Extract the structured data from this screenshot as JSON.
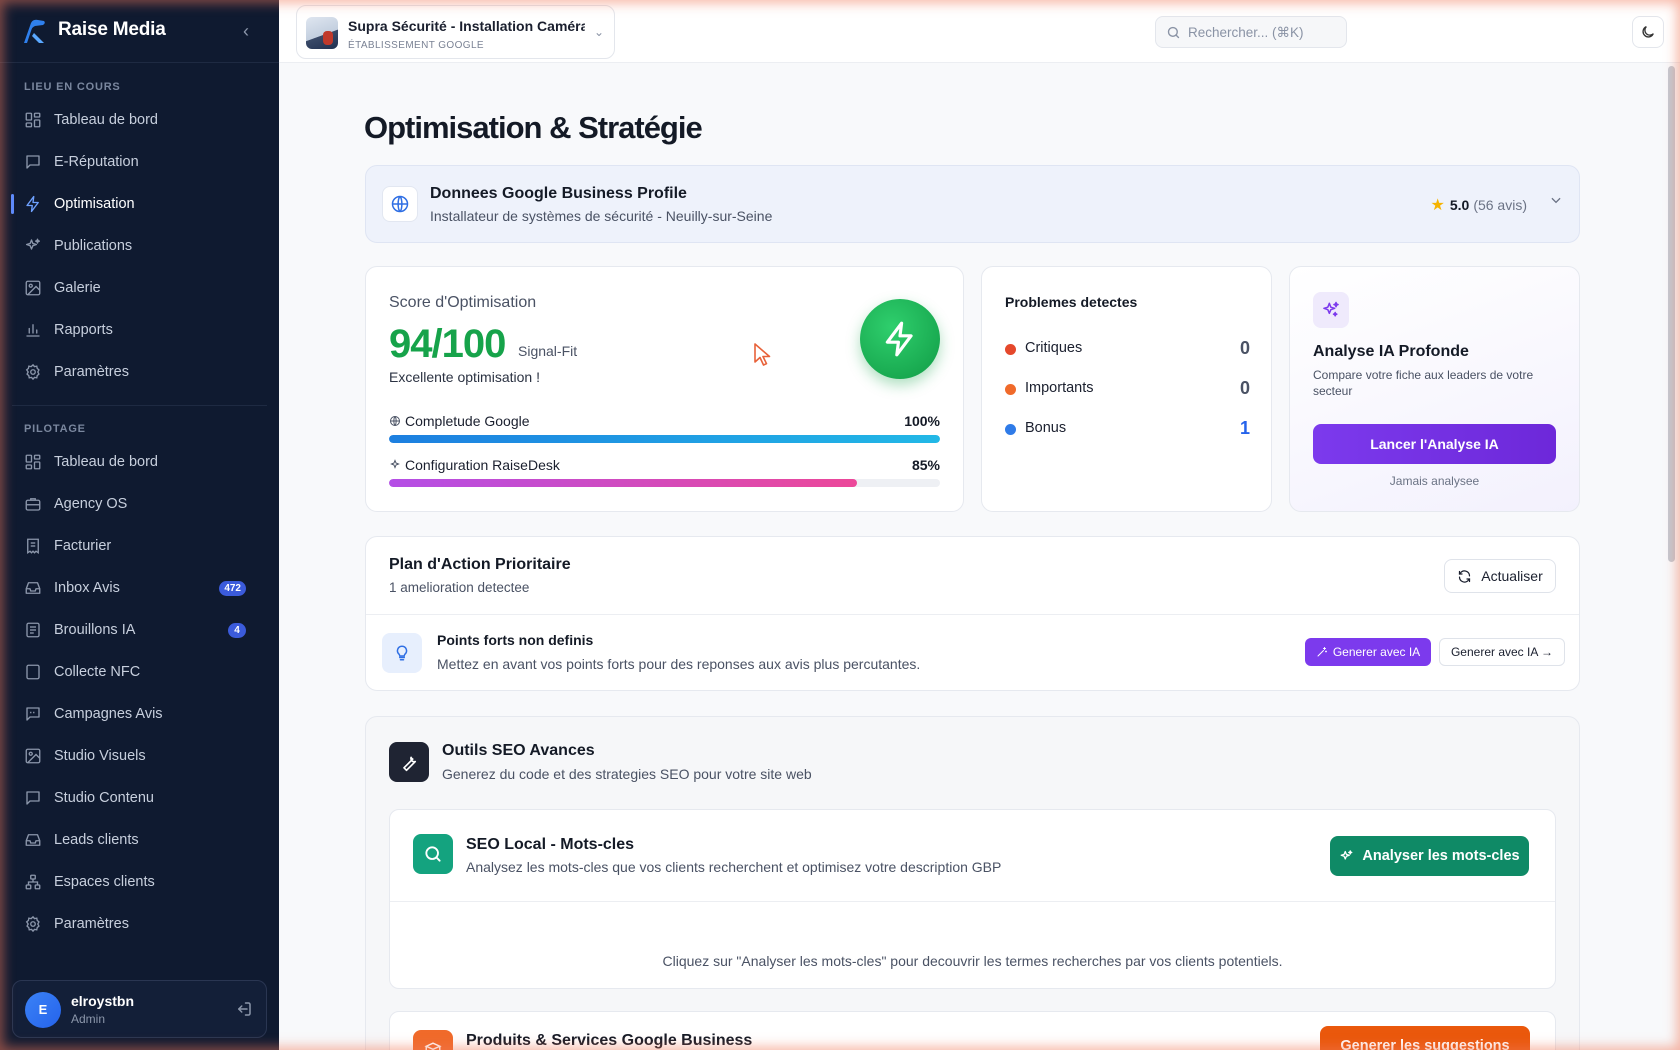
{
  "app": {
    "name": "Raise Media",
    "collapse_icon": "chevron-left-icon"
  },
  "sidebar": {
    "section_current": "LIEU EN COURS",
    "current_items": [
      {
        "label": "Tableau de bord",
        "icon": "dashboard-icon"
      },
      {
        "label": "E-Réputation",
        "icon": "message-square-icon"
      },
      {
        "label": "Optimisation",
        "icon": "zap-icon",
        "active": true
      },
      {
        "label": "Publications",
        "icon": "sparkles-icon"
      },
      {
        "label": "Galerie",
        "icon": "image-icon"
      },
      {
        "label": "Rapports",
        "icon": "bar-chart-icon"
      },
      {
        "label": "Paramètres",
        "icon": "gear-icon"
      }
    ],
    "section_pilotage": "PILOTAGE",
    "pilotage_items": [
      {
        "label": "Tableau de bord",
        "icon": "dashboard-icon"
      },
      {
        "label": "Agency OS",
        "icon": "briefcase-icon"
      },
      {
        "label": "Facturier",
        "icon": "receipt-icon"
      },
      {
        "label": "Inbox Avis",
        "icon": "inbox-icon",
        "badge": "472"
      },
      {
        "label": "Brouillons IA",
        "icon": "file-text-icon",
        "badge": "4"
      },
      {
        "label": "Collecte NFC",
        "icon": "nfc-card-icon"
      },
      {
        "label": "Campagnes Avis",
        "icon": "message-quote-icon"
      },
      {
        "label": "Studio Visuels",
        "icon": "image-icon"
      },
      {
        "label": "Studio Contenu",
        "icon": "message-square-icon"
      },
      {
        "label": "Leads clients",
        "icon": "inbox-icon"
      },
      {
        "label": "Espaces clients",
        "icon": "network-icon"
      },
      {
        "label": "Paramètres",
        "icon": "gear-icon"
      }
    ],
    "user": {
      "initial": "E",
      "name": "elroystbn",
      "role": "Admin"
    }
  },
  "topbar": {
    "location_name": "Supra Sécurité - Installation Caméra, ...",
    "location_sub": "ÉTABLISSEMENT GOOGLE",
    "search_placeholder": "Rechercher... (⌘K)",
    "theme_icon": "moon-icon"
  },
  "page": {
    "title": "Optimisation & Stratégie",
    "gbp": {
      "title": "Donnees Google Business Profile",
      "subtitle": "Installateur de systèmes de sécurité - Neuilly-sur-Seine",
      "rating": "5.0",
      "reviews": "(56 avis)"
    },
    "score": {
      "title": "Score d'Optimisation",
      "value": "94/100",
      "tag": "Signal-Fit",
      "subtitle": "Excellente optimisation !",
      "bars": [
        {
          "label": "Completude Google",
          "percent_text": "100%",
          "value": 100,
          "color_from": "#1d7fe0",
          "color_to": "#22b8e6"
        },
        {
          "label": "Configuration RaiseDesk",
          "percent_text": "85%",
          "value": 85,
          "color_from": "#b44ee6",
          "color_to": "#ec4899"
        }
      ]
    },
    "problems": {
      "title": "Problemes detectes",
      "rows": [
        {
          "label": "Critiques",
          "value": "0",
          "color": "#e5482b",
          "value_color": "#4a5264"
        },
        {
          "label": "Importants",
          "value": "0",
          "color": "#f06a2a",
          "value_color": "#4a5264"
        },
        {
          "label": "Bonus",
          "value": "1",
          "color": "#2f7be8",
          "value_color": "#2563eb"
        }
      ]
    },
    "ia": {
      "title": "Analyse IA Profonde",
      "subtitle": "Compare votre fiche aux leaders de votre secteur",
      "button": "Lancer l'Analyse IA",
      "footer": "Jamais analysee"
    },
    "plan": {
      "title": "Plan d'Action Prioritaire",
      "subtitle": "1 amelioration detectee",
      "refresh": "Actualiser",
      "item_title": "Points forts non definis",
      "item_sub": "Mettez en avant vos points forts pour des reponses aux avis plus percutantes.",
      "btn_primary": "Generer avec IA",
      "btn_secondary": "Generer avec IA →"
    },
    "seo": {
      "title": "Outils SEO Avances",
      "subtitle": "Generez du code et des strategies SEO pour votre site web",
      "kw_title": "SEO Local - Mots-cles",
      "kw_sub": "Analysez les mots-cles que vos clients recherchent et optimisez votre description GBP",
      "kw_button": "Analyser les mots-cles",
      "kw_empty": "Cliquez sur \"Analyser les mots-cles\" pour decouvrir les termes recherches par vos clients potentiels.",
      "prod_title": "Produits & Services Google Business",
      "prod_button": "Generer les suggestions"
    }
  }
}
